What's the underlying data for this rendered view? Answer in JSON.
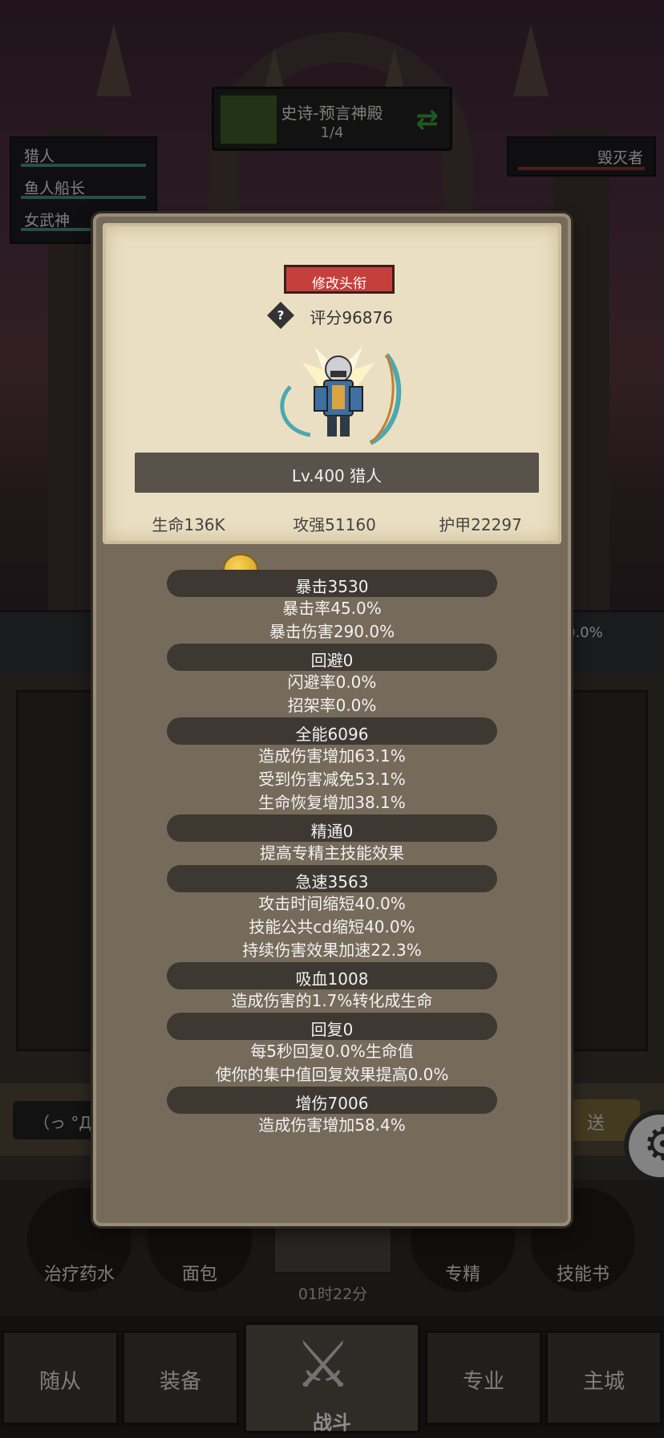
{
  "stage": {
    "title": "史诗-预言神殿",
    "count": "1/4"
  },
  "team": [
    {
      "name": "猎人"
    },
    {
      "name": "鱼人船长"
    },
    {
      "name": "女武神"
    }
  ],
  "enemy": {
    "name": "毁灭者"
  },
  "side_percent": "0.0%",
  "chat": {
    "input_text": "（っ °Д °",
    "send_label": "送"
  },
  "items": [
    {
      "label": "治疗药水"
    },
    {
      "label": "面包"
    },
    {
      "label": "专精"
    },
    {
      "label": "技能书"
    }
  ],
  "timer": "01时22分",
  "nav": {
    "tabs": [
      "随从",
      "装备",
      "专业",
      "主城"
    ],
    "battle": "战斗"
  },
  "popup": {
    "title_button": "修改头衔",
    "score": "评分96876",
    "name_level": "Lv.400 猎人",
    "core_stats": [
      "生命136K",
      "攻强51160",
      "护甲22297"
    ],
    "stat_groups": [
      {
        "header": "暴击3530",
        "lines": [
          "暴击率45.0%",
          "暴击伤害290.0%"
        ]
      },
      {
        "header": "回避0",
        "lines": [
          "闪避率0.0%",
          "招架率0.0%"
        ]
      },
      {
        "header": "全能6096",
        "lines": [
          "造成伤害增加63.1%",
          "受到伤害减免53.1%",
          "生命恢复增加38.1%"
        ]
      },
      {
        "header": "精通0",
        "lines": [
          "提高专精主技能效果"
        ]
      },
      {
        "header": "急速3563",
        "lines": [
          "攻击时间缩短40.0%",
          "技能公共cd缩短40.0%",
          "持续伤害效果加速22.3%"
        ]
      },
      {
        "header": "吸血1008",
        "lines": [
          "造成伤害的1.7%转化成生命"
        ]
      },
      {
        "header": "回复0",
        "lines": [
          "每5秒回复0.0%生命值",
          "使你的集中值回复效果提高0.0%"
        ]
      },
      {
        "header": "增伤7006",
        "lines": [
          "造成伤害增加58.4%"
        ]
      }
    ]
  },
  "colors": {
    "accent_red": "#c5403c",
    "parchment": "#eadfc3",
    "panel": "#766b5b",
    "team_hp": "#4a8f86",
    "enemy_hp": "#8a3a30",
    "stage_progress": "#3f5f27"
  }
}
